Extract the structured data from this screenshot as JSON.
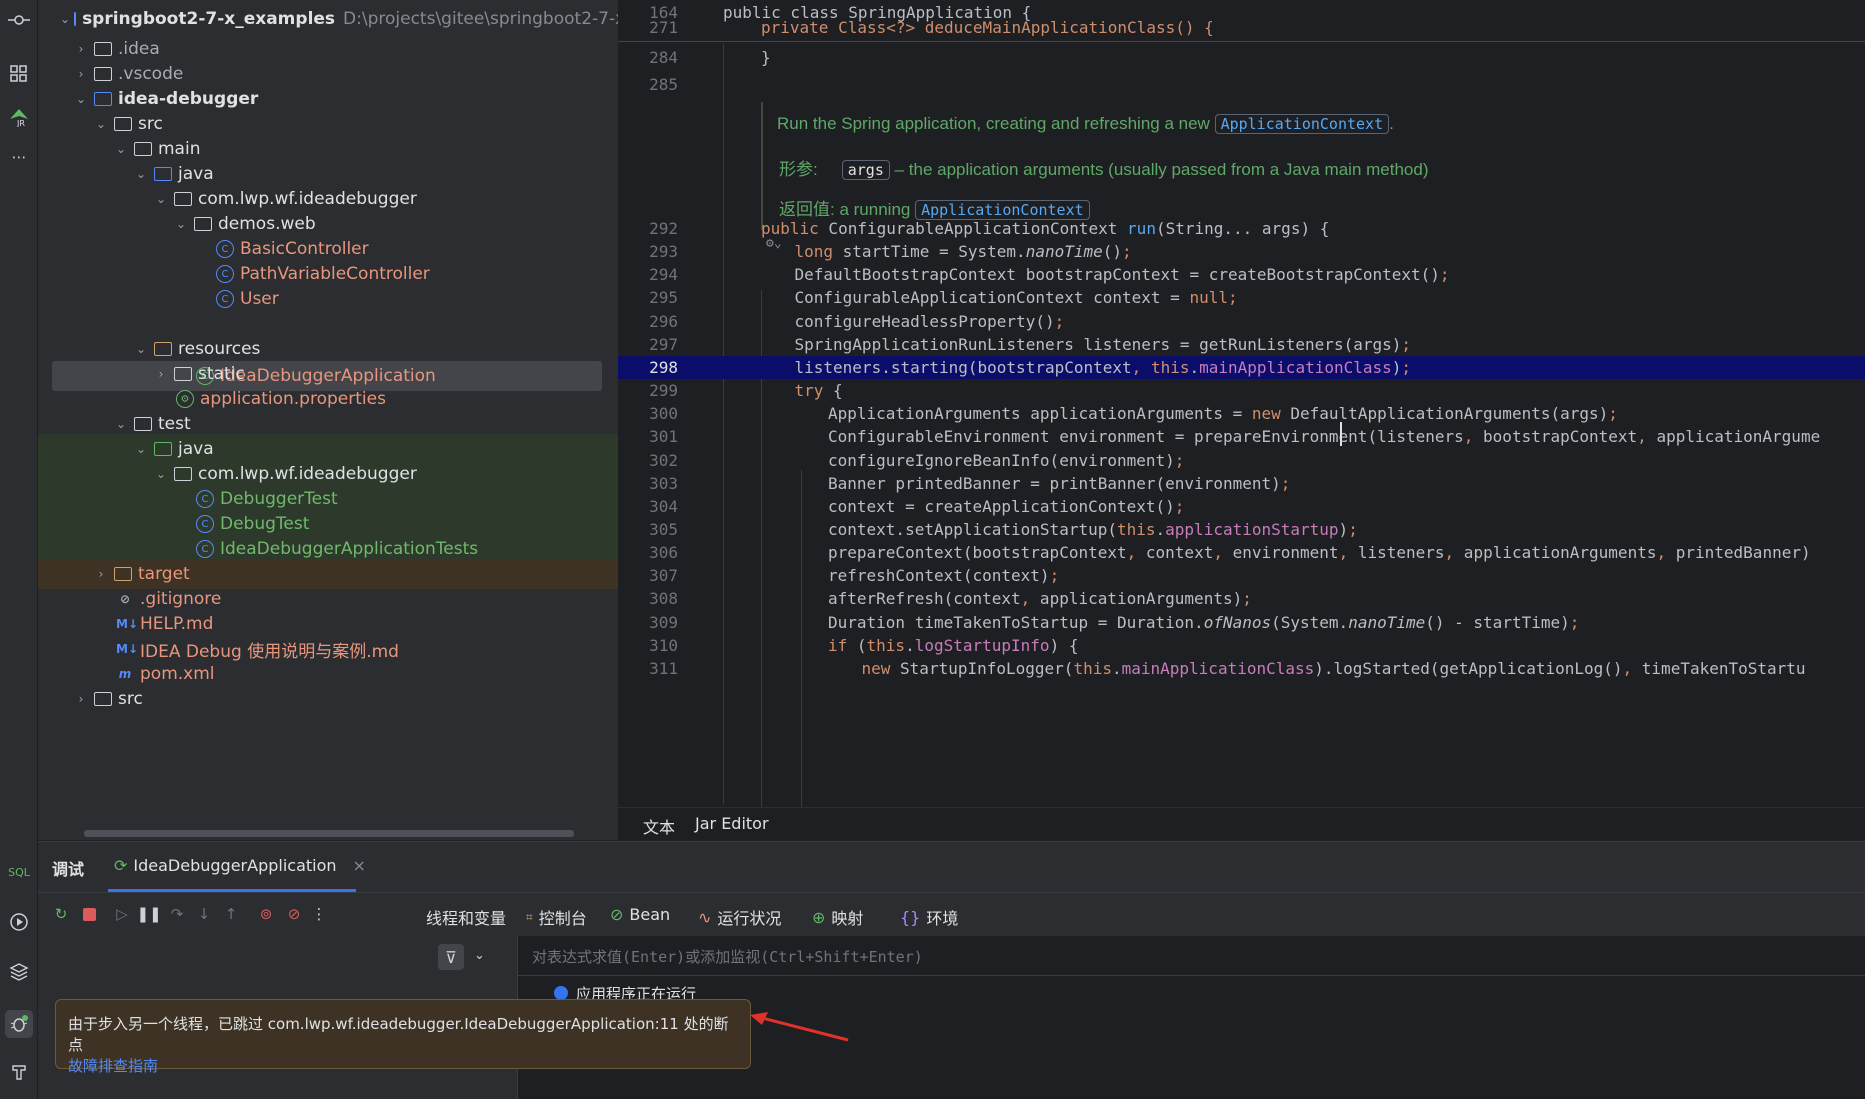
{
  "project_tree": {
    "root": {
      "name": "springboot2-7-x_examples",
      "path": "D:\\projects\\gitee\\springboot2-7-x_exam"
    },
    "items": [
      {
        "label": ".idea"
      },
      {
        "label": ".vscode"
      },
      {
        "label": "idea-debugger"
      },
      {
        "label": "src"
      },
      {
        "label": "main"
      },
      {
        "label": "java"
      },
      {
        "label": "com.lwp.wf.ideadebugger"
      },
      {
        "label": "demos.web"
      },
      {
        "label": "BasicController"
      },
      {
        "label": "PathVariableController"
      },
      {
        "label": "User"
      },
      {
        "label": "IdeaDebuggerApplication"
      },
      {
        "label": "resources"
      },
      {
        "label": "static"
      },
      {
        "label": "application.properties"
      },
      {
        "label": "test"
      },
      {
        "label": "java"
      },
      {
        "label": "com.lwp.wf.ideadebugger"
      },
      {
        "label": "DebuggerTest"
      },
      {
        "label": "DebugTest"
      },
      {
        "label": "IdeaDebuggerApplicationTests"
      },
      {
        "label": "target"
      },
      {
        "label": ".gitignore"
      },
      {
        "label": "HELP.md"
      },
      {
        "label": "IDEA Debug 使用说明与案例.md"
      },
      {
        "label": "pom.xml"
      },
      {
        "label": "src"
      }
    ]
  },
  "editor": {
    "sticky": [
      {
        "num": "164",
        "text": "public class SpringApplication {"
      },
      {
        "num": "271",
        "text": "private Class<?> deduceMainApplicationClass() {"
      }
    ],
    "pre_lines": [
      {
        "num": "284",
        "text": "}"
      },
      {
        "num": "285",
        "text": ""
      }
    ],
    "doc": {
      "summary": "Run the Spring application, creating and refreshing a new",
      "summary_chip": "ApplicationContext",
      "param_label": "形参:",
      "param_chip": "args",
      "param_text": "– the application arguments (usually passed from a Java main method)",
      "return_label": "返回值:",
      "return_text": "a running",
      "return_chip": "ApplicationContext"
    },
    "lines": [
      {
        "num": "292",
        "text": "public ConfigurableApplicationContext run(String... args) {"
      },
      {
        "num": "293",
        "text": "long startTime = System.nanoTime();"
      },
      {
        "num": "294",
        "text": "DefaultBootstrapContext bootstrapContext = createBootstrapContext();"
      },
      {
        "num": "295",
        "text": "ConfigurableApplicationContext context = null;"
      },
      {
        "num": "296",
        "text": "configureHeadlessProperty();"
      },
      {
        "num": "297",
        "text": "SpringApplicationRunListeners listeners = getRunListeners(args);"
      },
      {
        "num": "298",
        "text": "listeners.starting(bootstrapContext, this.mainApplicationClass);"
      },
      {
        "num": "299",
        "text": "try {"
      },
      {
        "num": "300",
        "text": "ApplicationArguments applicationArguments = new DefaultApplicationArguments(args);"
      },
      {
        "num": "301",
        "text": "ConfigurableEnvironment environment = prepareEnvironment(listeners, bootstrapContext, applicationArgume"
      },
      {
        "num": "302",
        "text": "configureIgnoreBeanInfo(environment);"
      },
      {
        "num": "303",
        "text": "Banner printedBanner = printBanner(environment);"
      },
      {
        "num": "304",
        "text": "context = createApplicationContext();"
      },
      {
        "num": "305",
        "text": "context.setApplicationStartup(this.applicationStartup);"
      },
      {
        "num": "306",
        "text": "prepareContext(bootstrapContext, context, environment, listeners, applicationArguments, printedBanner)"
      },
      {
        "num": "307",
        "text": "refreshContext(context);"
      },
      {
        "num": "308",
        "text": "afterRefresh(context, applicationArguments);"
      },
      {
        "num": "309",
        "text": "Duration timeTakenToStartup = Duration.ofNanos(System.nanoTime() - startTime);"
      },
      {
        "num": "310",
        "text": "if (this.logStartupInfo) {"
      },
      {
        "num": "311",
        "text": "new StartupInfoLogger(this.mainApplicationClass).logStarted(getApplicationLog(), timeTakenToStartu"
      }
    ],
    "tabs": {
      "text": "文本",
      "jar": "Jar Editor"
    }
  },
  "debug": {
    "tab_label": "调试",
    "session_label": "IdeaDebuggerApplication",
    "close": "×",
    "views": {
      "threads": "线程和变量",
      "console": "控制台",
      "bean": "Bean",
      "health": "运行状况",
      "mappings": "映射",
      "env": "环境"
    },
    "watch_placeholder": "对表达式求值(Enter)或添加监视(Ctrl+Shift+Enter)",
    "status_partial": "应用程序正在运行"
  },
  "tooltip": {
    "message": "由于步入另一个线程，已跳过 com.lwp.wf.ideadebugger.IdeaDebuggerApplication:11 处的断点",
    "link": "故障排查指南"
  },
  "side_labels": {
    "sql": "SQL"
  },
  "colors": {
    "highlight_line": "#0b0d6a",
    "accent": "#3574f0",
    "arrow": "#e0312b"
  }
}
